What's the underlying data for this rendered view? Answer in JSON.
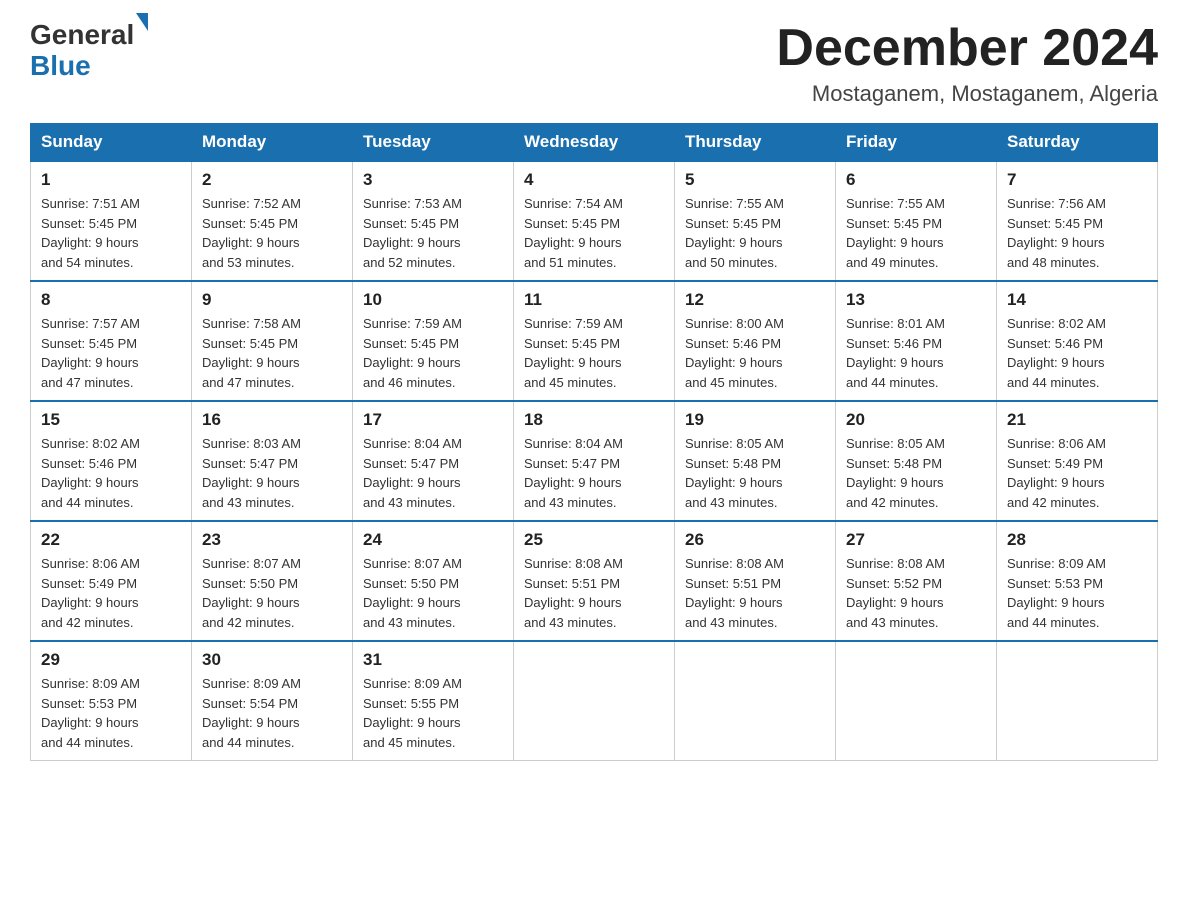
{
  "logo": {
    "general": "General",
    "blue": "Blue"
  },
  "header": {
    "month": "December 2024",
    "location": "Mostaganem, Mostaganem, Algeria"
  },
  "days_of_week": [
    "Sunday",
    "Monday",
    "Tuesday",
    "Wednesday",
    "Thursday",
    "Friday",
    "Saturday"
  ],
  "weeks": [
    [
      {
        "day": "1",
        "sunrise": "7:51 AM",
        "sunset": "5:45 PM",
        "daylight": "9 hours and 54 minutes."
      },
      {
        "day": "2",
        "sunrise": "7:52 AM",
        "sunset": "5:45 PM",
        "daylight": "9 hours and 53 minutes."
      },
      {
        "day": "3",
        "sunrise": "7:53 AM",
        "sunset": "5:45 PM",
        "daylight": "9 hours and 52 minutes."
      },
      {
        "day": "4",
        "sunrise": "7:54 AM",
        "sunset": "5:45 PM",
        "daylight": "9 hours and 51 minutes."
      },
      {
        "day": "5",
        "sunrise": "7:55 AM",
        "sunset": "5:45 PM",
        "daylight": "9 hours and 50 minutes."
      },
      {
        "day": "6",
        "sunrise": "7:55 AM",
        "sunset": "5:45 PM",
        "daylight": "9 hours and 49 minutes."
      },
      {
        "day": "7",
        "sunrise": "7:56 AM",
        "sunset": "5:45 PM",
        "daylight": "9 hours and 48 minutes."
      }
    ],
    [
      {
        "day": "8",
        "sunrise": "7:57 AM",
        "sunset": "5:45 PM",
        "daylight": "9 hours and 47 minutes."
      },
      {
        "day": "9",
        "sunrise": "7:58 AM",
        "sunset": "5:45 PM",
        "daylight": "9 hours and 47 minutes."
      },
      {
        "day": "10",
        "sunrise": "7:59 AM",
        "sunset": "5:45 PM",
        "daylight": "9 hours and 46 minutes."
      },
      {
        "day": "11",
        "sunrise": "7:59 AM",
        "sunset": "5:45 PM",
        "daylight": "9 hours and 45 minutes."
      },
      {
        "day": "12",
        "sunrise": "8:00 AM",
        "sunset": "5:46 PM",
        "daylight": "9 hours and 45 minutes."
      },
      {
        "day": "13",
        "sunrise": "8:01 AM",
        "sunset": "5:46 PM",
        "daylight": "9 hours and 44 minutes."
      },
      {
        "day": "14",
        "sunrise": "8:02 AM",
        "sunset": "5:46 PM",
        "daylight": "9 hours and 44 minutes."
      }
    ],
    [
      {
        "day": "15",
        "sunrise": "8:02 AM",
        "sunset": "5:46 PM",
        "daylight": "9 hours and 44 minutes."
      },
      {
        "day": "16",
        "sunrise": "8:03 AM",
        "sunset": "5:47 PM",
        "daylight": "9 hours and 43 minutes."
      },
      {
        "day": "17",
        "sunrise": "8:04 AM",
        "sunset": "5:47 PM",
        "daylight": "9 hours and 43 minutes."
      },
      {
        "day": "18",
        "sunrise": "8:04 AM",
        "sunset": "5:47 PM",
        "daylight": "9 hours and 43 minutes."
      },
      {
        "day": "19",
        "sunrise": "8:05 AM",
        "sunset": "5:48 PM",
        "daylight": "9 hours and 43 minutes."
      },
      {
        "day": "20",
        "sunrise": "8:05 AM",
        "sunset": "5:48 PM",
        "daylight": "9 hours and 42 minutes."
      },
      {
        "day": "21",
        "sunrise": "8:06 AM",
        "sunset": "5:49 PM",
        "daylight": "9 hours and 42 minutes."
      }
    ],
    [
      {
        "day": "22",
        "sunrise": "8:06 AM",
        "sunset": "5:49 PM",
        "daylight": "9 hours and 42 minutes."
      },
      {
        "day": "23",
        "sunrise": "8:07 AM",
        "sunset": "5:50 PM",
        "daylight": "9 hours and 42 minutes."
      },
      {
        "day": "24",
        "sunrise": "8:07 AM",
        "sunset": "5:50 PM",
        "daylight": "9 hours and 43 minutes."
      },
      {
        "day": "25",
        "sunrise": "8:08 AM",
        "sunset": "5:51 PM",
        "daylight": "9 hours and 43 minutes."
      },
      {
        "day": "26",
        "sunrise": "8:08 AM",
        "sunset": "5:51 PM",
        "daylight": "9 hours and 43 minutes."
      },
      {
        "day": "27",
        "sunrise": "8:08 AM",
        "sunset": "5:52 PM",
        "daylight": "9 hours and 43 minutes."
      },
      {
        "day": "28",
        "sunrise": "8:09 AM",
        "sunset": "5:53 PM",
        "daylight": "9 hours and 44 minutes."
      }
    ],
    [
      {
        "day": "29",
        "sunrise": "8:09 AM",
        "sunset": "5:53 PM",
        "daylight": "9 hours and 44 minutes."
      },
      {
        "day": "30",
        "sunrise": "8:09 AM",
        "sunset": "5:54 PM",
        "daylight": "9 hours and 44 minutes."
      },
      {
        "day": "31",
        "sunrise": "8:09 AM",
        "sunset": "5:55 PM",
        "daylight": "9 hours and 45 minutes."
      },
      null,
      null,
      null,
      null
    ]
  ],
  "labels": {
    "sunrise": "Sunrise:",
    "sunset": "Sunset:",
    "daylight": "Daylight:"
  }
}
